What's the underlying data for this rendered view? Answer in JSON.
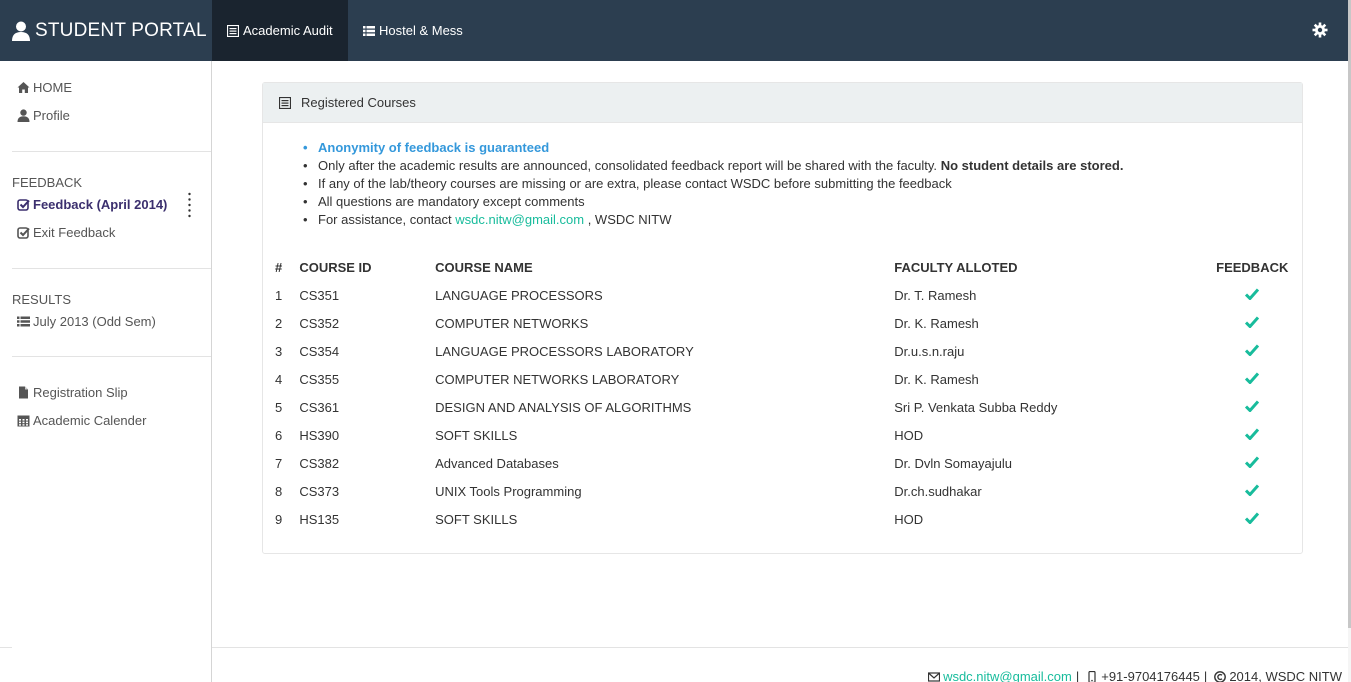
{
  "navbar": {
    "brand": "STUDENT PORTAL",
    "items": [
      {
        "label": "Academic Audit",
        "icon": "list-alt-icon"
      },
      {
        "label": "Hostel & Mess",
        "icon": "list-icon"
      }
    ],
    "settings_icon": "gear-icon",
    "bg_color": "#2c3e50"
  },
  "sidebar": {
    "top_links": [
      {
        "label": "HOME",
        "icon": "home-icon"
      },
      {
        "label": "Profile",
        "icon": "user-icon"
      }
    ],
    "feedback_heading": "FEEDBACK",
    "feedback_links": [
      {
        "label": "Feedback (April 2014)",
        "icon": "check-square-icon",
        "active": true
      },
      {
        "label": "Exit Feedback",
        "icon": "check-square-icon"
      }
    ],
    "results_heading": "RESULTS",
    "results_links": [
      {
        "label": "July 2013 (Odd Sem)",
        "icon": "list-icon"
      }
    ],
    "other_links": [
      {
        "label": "Registration Slip",
        "icon": "file-icon"
      },
      {
        "label": "Academic Calender",
        "icon": "calendar-icon"
      }
    ]
  },
  "panel": {
    "title": "Registered Courses",
    "notes": {
      "n1": "Anonymity of feedback is guaranteed",
      "n2_text": "Only after the academic results are announced, consolidated feedback report will be shared with the faculty.",
      "n2_bold": "No student details are stored.",
      "n3": "If any of the lab/theory courses are missing or are extra, please contact WSDC before submitting the feedback",
      "n4": "All questions are mandatory except comments",
      "n5_prefix": "For assistance, contact",
      "n5_email": "wsdc.nitw@gmail.com",
      "n5_suffix": ", WSDC NITW"
    },
    "table": {
      "headers": {
        "no": "#",
        "id": "COURSE ID",
        "name": "COURSE NAME",
        "faculty": "FACULTY ALLOTED",
        "feedback": "FEEDBACK"
      },
      "rows": [
        {
          "no": "1",
          "id": "CS351",
          "name": "LANGUAGE PROCESSORS",
          "faculty": "Dr. T. Ramesh",
          "feedback": "done"
        },
        {
          "no": "2",
          "id": "CS352",
          "name": "COMPUTER NETWORKS",
          "faculty": "Dr. K. Ramesh",
          "feedback": "done"
        },
        {
          "no": "3",
          "id": "CS354",
          "name": "LANGUAGE PROCESSORS LABORATORY",
          "faculty": "Dr.u.s.n.raju",
          "feedback": "done"
        },
        {
          "no": "4",
          "id": "CS355",
          "name": "COMPUTER NETWORKS LABORATORY",
          "faculty": "Dr. K. Ramesh",
          "feedback": "done"
        },
        {
          "no": "5",
          "id": "CS361",
          "name": "DESIGN AND ANALYSIS OF ALGORITHMS",
          "faculty": "Sri P. Venkata Subba Reddy",
          "feedback": "done"
        },
        {
          "no": "6",
          "id": "HS390",
          "name": "SOFT SKILLS",
          "faculty": "HOD",
          "feedback": "done"
        },
        {
          "no": "7",
          "id": "CS382",
          "name": "Advanced Databases",
          "faculty": "Dr. Dvln Somayajulu",
          "feedback": "done"
        },
        {
          "no": "8",
          "id": "CS373",
          "name": "UNIX Tools Programming",
          "faculty": "Dr.ch.sudhakar",
          "feedback": "done"
        },
        {
          "no": "9",
          "id": "HS135",
          "name": "SOFT SKILLS",
          "faculty": "HOD",
          "feedback": "done"
        }
      ],
      "check_color": "#18bc9c"
    }
  },
  "footer": {
    "email": "wsdc.nitw@gmail.com",
    "phone": "+91-9704176445",
    "copyright": "2014, WSDC NITW",
    "sep1": "|",
    "sep2": "|"
  }
}
